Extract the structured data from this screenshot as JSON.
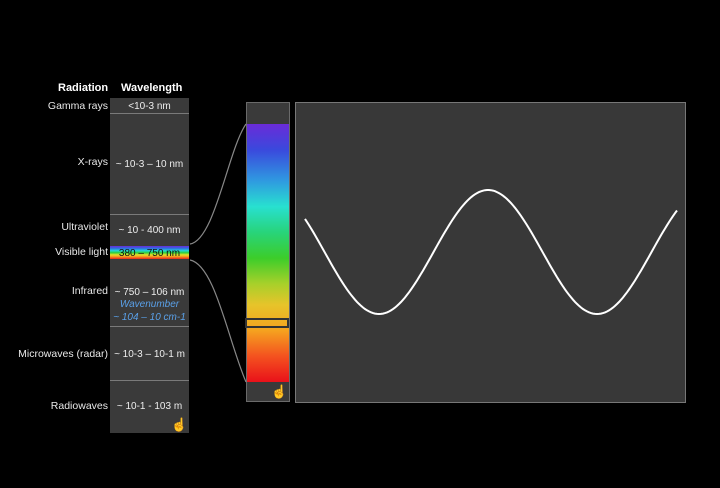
{
  "header": {
    "radiation": "Radiation",
    "wavelength": "Wavelength"
  },
  "rows": [
    {
      "name": "Gamma rays",
      "wavelength": "<10-3 nm"
    },
    {
      "name": "X-rays",
      "wavelength": "~ 10-3 – 10 nm"
    },
    {
      "name": "Ultraviolet",
      "wavelength": "~ 10 - 400 nm"
    },
    {
      "name": "Visible light",
      "wavelength": "380 – 750 nm"
    },
    {
      "name": "Infrared",
      "wavelength": "~ 750 – 106 nm"
    },
    {
      "name": "Microwaves (radar)",
      "wavelength": "~ 10-3 – 10-1 m"
    },
    {
      "name": "Radiowaves",
      "wavelength": "~ 10-1 - 103 m"
    }
  ],
  "infrared_wavenumber": {
    "label": "Wavenumber",
    "value": "~  104 – 10 cm-1"
  },
  "icons": [
    "hand-pointer-icon",
    "hand-pointer-icon"
  ],
  "colors": {
    "panel": "#3a3a3a",
    "wave": "#ffffff",
    "wavenumber": "#5aa0e8"
  }
}
